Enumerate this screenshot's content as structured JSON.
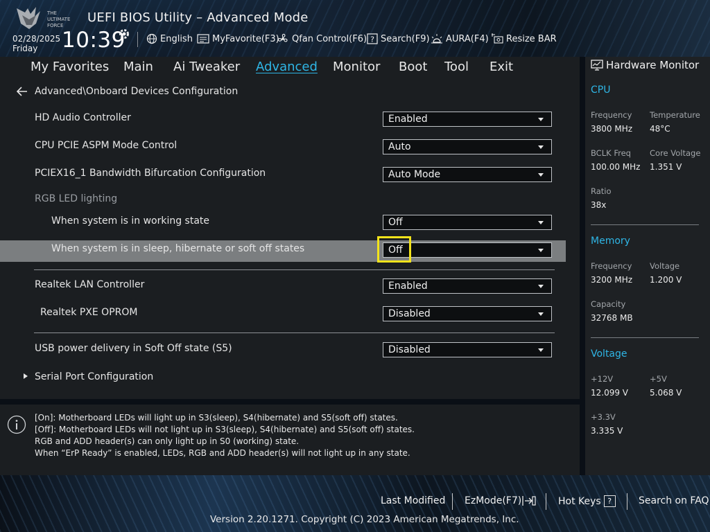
{
  "header": {
    "title": "UEFI BIOS Utility – Advanced Mode",
    "logo_text": "THE ULTIMATE FORCE",
    "date": "02/28/2025",
    "day": "Friday",
    "time": "10:39",
    "toolbar": [
      {
        "label": "English",
        "icon": "globe-icon"
      },
      {
        "label": "MyFavorite(F3)",
        "icon": "favorite-list-icon"
      },
      {
        "label": "Qfan Control(F6)",
        "icon": "fan-icon"
      },
      {
        "label": "Search(F9)",
        "icon": "search-help-icon"
      },
      {
        "label": "AURA(F4)",
        "icon": "aura-light-icon"
      },
      {
        "label": "Resize BAR",
        "icon": "resize-bar-icon"
      }
    ]
  },
  "nav": {
    "tabs": [
      "My Favorites",
      "Main",
      "Ai Tweaker",
      "Advanced",
      "Monitor",
      "Boot",
      "Tool",
      "Exit"
    ],
    "active": "Advanced"
  },
  "main": {
    "breadcrumb": "Advanced\\Onboard Devices Configuration",
    "rows": [
      {
        "label": "HD Audio Controller",
        "value": "Enabled"
      },
      {
        "label": "CPU PCIE ASPM Mode Control",
        "value": "Auto"
      },
      {
        "label": "PCIEX16_1 Bandwidth Bifurcation Configuration",
        "value": "Auto Mode"
      },
      {
        "label": "RGB LED lighting"
      },
      {
        "label": "When system is in working state",
        "value": "Off"
      },
      {
        "label": "When system is in sleep, hibernate or soft off states",
        "value": "Off"
      },
      {
        "label": "Realtek LAN Controller",
        "value": "Enabled"
      },
      {
        "label": "Realtek PXE OPROM",
        "value": "Disabled"
      },
      {
        "label": "USB power delivery in Soft Off state (S5)",
        "value": "Disabled"
      },
      {
        "label": "Serial Port Configuration"
      }
    ],
    "selected_row": "When system is in sleep, hibernate or soft off states"
  },
  "help": {
    "lines": [
      "[On]: Motherboard LEDs will light up in S3(sleep), S4(hibernate) and S5(soft off) states.",
      "[Off]: Motherboard LEDs will not light up in S3(sleep), S4(hibernate) and S5(soft off) states.",
      "RGB and ADD header(s) can only light up in S0 (working) state.",
      "When “ErP Ready” is enabled, LEDs, RGB and ADD header(s) will not light up in any state."
    ]
  },
  "hardware_monitor": {
    "title": "Hardware Monitor",
    "cpu": {
      "heading": "CPU",
      "frequency_label": "Frequency",
      "frequency": "3800 MHz",
      "temperature_label": "Temperature",
      "temperature": "48°C",
      "bclk_label": "BCLK Freq",
      "bclk": "100.00 MHz",
      "core_voltage_label": "Core Voltage",
      "core_voltage": "1.351 V",
      "ratio_label": "Ratio",
      "ratio": "38x"
    },
    "memory": {
      "heading": "Memory",
      "frequency_label": "Frequency",
      "frequency": "3200 MHz",
      "voltage_label": "Voltage",
      "voltage": "1.200 V",
      "capacity_label": "Capacity",
      "capacity": "32768 MB"
    },
    "voltage": {
      "heading": "Voltage",
      "v12_label": "+12V",
      "v12": "12.099 V",
      "v5_label": "+5V",
      "v5": "5.068 V",
      "v33_label": "+3.3V",
      "v33": "3.335 V"
    }
  },
  "footer": {
    "last_modified": "Last Modified",
    "ezmode": "EzMode(F7)",
    "hotkeys": "Hot Keys",
    "hotkeys_key": "?",
    "faq": "Search on FAQ",
    "copyright": "Version 2.20.1271. Copyright (C) 2023 American Megatrends, Inc."
  },
  "colors": {
    "accent": "#2fb6e6",
    "focus": "#f2e31b",
    "selected_row": "#7b7e80",
    "panel": "#1b1e21"
  }
}
